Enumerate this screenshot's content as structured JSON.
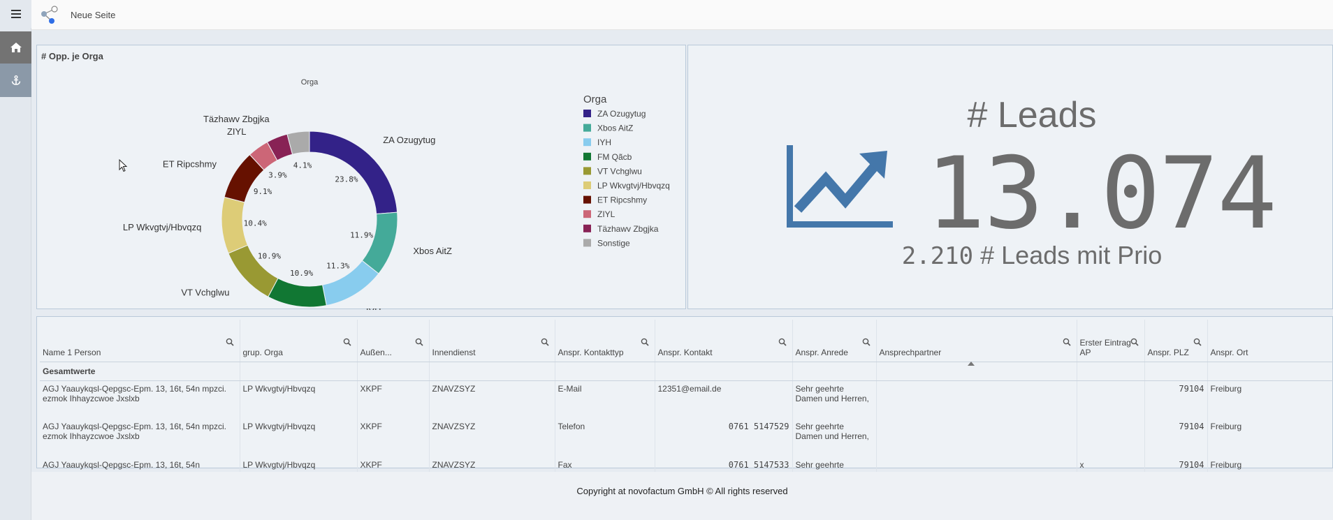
{
  "app": {
    "page_title": "Neue Seite",
    "footer": "Copyright at novofactum GmbH © All rights reserved"
  },
  "icons": {
    "menu": "hamburger-icon",
    "home": "home-icon",
    "anchor": "anchor-icon",
    "logo": "network-logo-icon",
    "search": "search-icon",
    "kpi": "trend-up-icon"
  },
  "chart": {
    "title": "# Opp. je Orga",
    "dimension_label": "Orga",
    "legend_title": "Orga"
  },
  "chart_data": {
    "type": "pie",
    "title": "# Opp. je Orga",
    "labels": [
      "ZA Ozugytug",
      "Xbos AitZ",
      "IYH",
      "FM Qãcb",
      "VT Vchglwu",
      "LP Wkvgtvj/Hbvqzq",
      "ET Ripcshmy",
      "ZIYL",
      "Täzhawv Zbgjka",
      "Sonstige"
    ],
    "values": [
      23.8,
      11.9,
      11.3,
      10.9,
      10.9,
      10.4,
      9.1,
      3.9,
      3.9,
      4.1
    ],
    "value_labels": [
      "23.8%",
      "11.9%",
      "11.3%",
      "10.9%",
      "10.9%",
      "10.4%",
      "9.1%",
      "3.9%",
      "",
      "4.1%"
    ],
    "colors": [
      "#332288",
      "#44aa99",
      "#88ccee",
      "#117733",
      "#999933",
      "#ddcc77",
      "#661100",
      "#cc6677",
      "#882255",
      "#aaaaaa"
    ],
    "legend_placement": "right"
  },
  "kpi": {
    "title": "# Leads",
    "value": "13.074",
    "sub_value": "2.210",
    "sub_label": "# Leads mit Prio",
    "accent": "#4477aa"
  },
  "table": {
    "columns": [
      {
        "label": "Name 1 Person",
        "search": true
      },
      {
        "label": "grup. Orga",
        "search": true
      },
      {
        "label": "Außen...",
        "search": true
      },
      {
        "label": "Innendienst",
        "search": true
      },
      {
        "label": "Anspr. Kontakttyp",
        "search": true
      },
      {
        "label": "Anspr. Kontakt",
        "search": true
      },
      {
        "label": "Anspr. Anrede",
        "search": true
      },
      {
        "label": "Ansprechpartner",
        "search": true
      },
      {
        "label": "Erster Eintrag AP",
        "search": true
      },
      {
        "label": "Anspr. PLZ",
        "search": true
      },
      {
        "label": "Anspr. Ort",
        "search": false
      }
    ],
    "total_label": "Gesamtwerte",
    "rows": [
      [
        "AGJ Yaauykqsl-Qepgsc-Epm. 13, 16t, 54n mpzci. ezmok Ihhayzcwoe Jxslxb",
        "LP Wkvgtvj/Hbvqzq",
        "XKPF",
        "ZNAVZSYZ",
        "E-Mail",
        "12351@email.de",
        "Sehr geehrte Damen und Herren,",
        "",
        "",
        "79104",
        "Freiburg"
      ],
      [
        "AGJ Yaauykqsl-Qepgsc-Epm. 13, 16t, 54n mpzci. ezmok Ihhayzcwoe Jxslxb",
        "LP Wkvgtvj/Hbvqzq",
        "XKPF",
        "ZNAVZSYZ",
        "Telefon",
        "0761 5147529",
        "Sehr geehrte Damen und Herren,",
        "",
        "",
        "79104",
        "Freiburg"
      ],
      [
        "AGJ Yaauykqsl-Qepgsc-Epm. 13, 16t, 54n",
        "LP Wkvgtvj/Hbvqzq",
        "XKPF",
        "ZNAVZSYZ",
        "Fax",
        "0761 5147533",
        "Sehr geehrte",
        "",
        "x",
        "79104",
        "Freiburg"
      ]
    ]
  }
}
